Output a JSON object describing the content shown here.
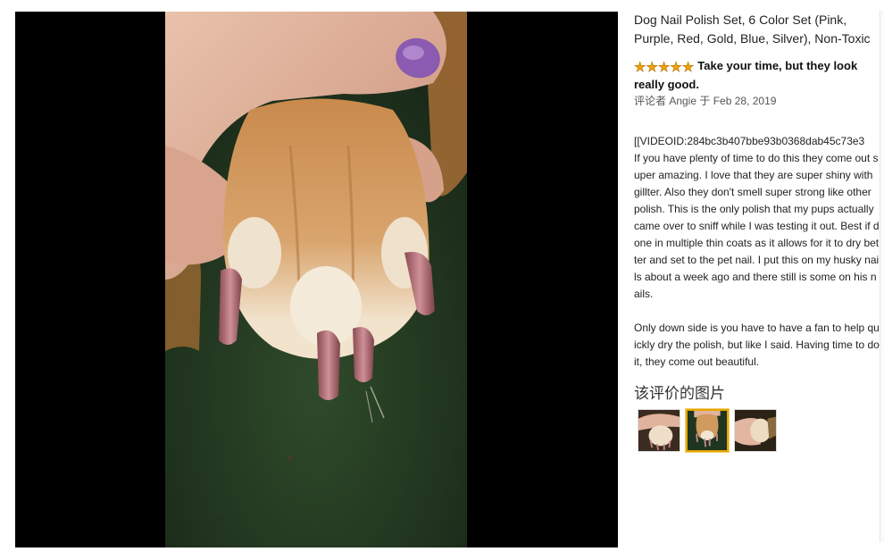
{
  "product": {
    "title": "Dog Nail Polish Set, 6 Color Set (Pink,\nPurple, Red, Gold, Blue, Silver), Non-Toxic"
  },
  "review": {
    "rating": 5,
    "star_glyph": "★",
    "title": "Take your time, but they look really good.",
    "byline": "评论者 Angie 于 Feb 28, 2019",
    "video_id": "[[VIDEOID:284bc3b407bbe93b0368dab45c73e3",
    "body": "If you have plenty of time to do this they come out super amazing. I love that they are super shiny with gillter. Also they don't smell super strong like other polish. This is the only polish that my pups actually came over to sniff while I was testing it out. Best if done in multiple thin coats as it allows for it to dry better and set to the pet nail. I put this on my husky nails about a week ago and there still is some on his nails.\n\nOnly down side is you have to have a fan to help quickly dry the polish, but like I said. Having time to do it, they come out beautiful."
  },
  "images_section": {
    "heading": "该评价的图片",
    "selected_index": 1,
    "thumbnails": [
      "paw-photo-1",
      "paw-photo-2",
      "paw-photo-3"
    ]
  },
  "colors": {
    "star": "#f0a30a",
    "selected_border": "#e7a500",
    "viewer_bg": "#000000"
  }
}
